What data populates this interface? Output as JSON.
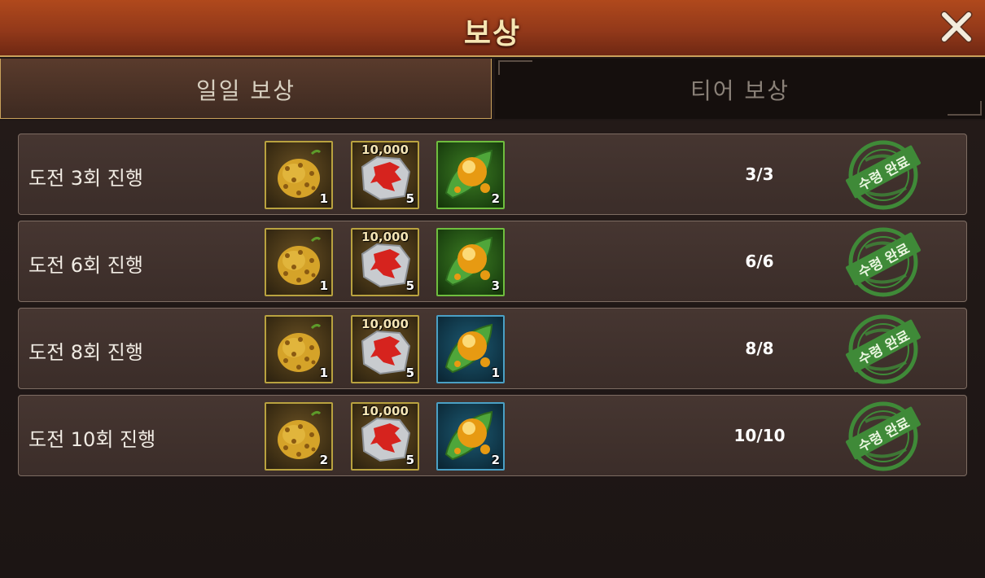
{
  "header": {
    "title": "보상",
    "close_icon": "close-x-icon"
  },
  "tabs": [
    {
      "label": "일일 보상",
      "active": true
    },
    {
      "label": "티어 보상",
      "active": false
    }
  ],
  "rows": [
    {
      "label": "도전 3회 진행",
      "rewards": [
        {
          "icon": "kiwano-fruit-icon",
          "count": "1"
        },
        {
          "icon": "wolf-stone-icon",
          "amount": "10,000",
          "count": "5"
        },
        {
          "icon": "amber-drop-leaf-icon",
          "frame": "green",
          "count": "2"
        }
      ],
      "progress": "3/3",
      "status": "수령 완료"
    },
    {
      "label": "도전 6회 진행",
      "rewards": [
        {
          "icon": "kiwano-fruit-icon",
          "count": "1"
        },
        {
          "icon": "wolf-stone-icon",
          "amount": "10,000",
          "count": "5"
        },
        {
          "icon": "amber-drop-leaf-icon",
          "frame": "green",
          "count": "3"
        }
      ],
      "progress": "6/6",
      "status": "수령 완료"
    },
    {
      "label": "도전 8회 진행",
      "rewards": [
        {
          "icon": "kiwano-fruit-icon",
          "count": "1"
        },
        {
          "icon": "wolf-stone-icon",
          "amount": "10,000",
          "count": "5"
        },
        {
          "icon": "amber-drop-leaf-icon",
          "frame": "blue",
          "count": "1"
        }
      ],
      "progress": "8/8",
      "status": "수령 완료"
    },
    {
      "label": "도전 10회 진행",
      "rewards": [
        {
          "icon": "kiwano-fruit-icon",
          "count": "2"
        },
        {
          "icon": "wolf-stone-icon",
          "amount": "10,000",
          "count": "5"
        },
        {
          "icon": "amber-drop-leaf-icon",
          "frame": "blue",
          "count": "2"
        }
      ],
      "progress": "10/10",
      "status": "수령 완료"
    }
  ],
  "colors": {
    "header": "#93391a",
    "gold_border": "#c9a15b",
    "stamp_green": "#3f8a38"
  }
}
